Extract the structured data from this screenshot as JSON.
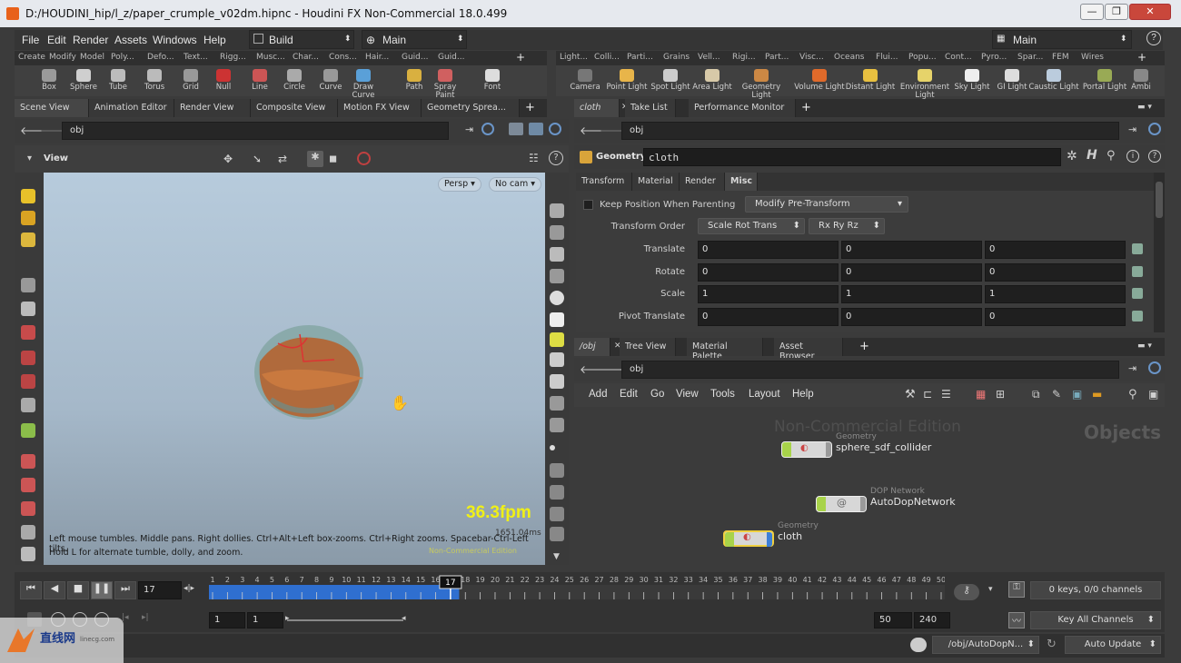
{
  "window": {
    "title": "D:/HOUDINI_hip/l_z/paper_crumple_v02dm.hipnc - Houdini FX Non-Commercial 18.0.499",
    "min": "—",
    "max": "❐",
    "close": "✕"
  },
  "menu": {
    "items": [
      "File",
      "Edit",
      "Render",
      "Assets",
      "Windows",
      "Help"
    ],
    "build": "Build",
    "desktop": "Main",
    "right_desktop": "Main",
    "help": "?"
  },
  "shelf_left": {
    "tabs": [
      "Create",
      "Modify",
      "Model",
      "Poly...",
      "Defo...",
      "Text...",
      "Rigg...",
      "Musc...",
      "Char...",
      "Cons...",
      "Hair...",
      "Guid...",
      "Guid..."
    ],
    "tools": [
      "Box",
      "Sphere",
      "Tube",
      "Torus",
      "Grid",
      "Null",
      "Line",
      "Circle",
      "Curve",
      "Draw Curve",
      "Path",
      "Spray Paint",
      "Font"
    ]
  },
  "shelf_right": {
    "tabs": [
      "Light...",
      "Colli...",
      "Parti...",
      "Grains",
      "Vell...",
      "Rigi...",
      "Part...",
      "Visc...",
      "Oceans",
      "Flui...",
      "Popu...",
      "Cont...",
      "Pyro...",
      "Spar...",
      "FEM",
      "Wires"
    ],
    "tools": [
      "Camera",
      "Point Light",
      "Spot Light",
      "Area Light",
      "Geometry Light",
      "Volume Light",
      "Distant Light",
      "Environment Light",
      "Sky Light",
      "GI Light",
      "Caustic Light",
      "Portal Light",
      "Ambi"
    ]
  },
  "scene_pane": {
    "tabs": [
      "Scene View",
      "Animation Editor",
      "Render View",
      "Composite View",
      "Motion FX View",
      "Geometry Sprea..."
    ],
    "path": "obj",
    "view_label": "View",
    "persp": "Persp ▾",
    "cam": "No cam ▾",
    "fps": "36.3fpm",
    "ms": "1651.04ms",
    "hint_line1": "Left mouse tumbles. Middle pans. Right dollies. Ctrl+Alt+Left box-zooms. Ctrl+Right zooms. Spacebar-Ctrl-Left tilts.",
    "hint_line2": "Hold L for alternate tumble, dolly, and zoom.",
    "watermark": "Non-Commercial Edition"
  },
  "param_pane": {
    "tabs": [
      "cloth",
      "Take List",
      "Performance Monitor"
    ],
    "path": "obj",
    "node_type": "Geometry",
    "node_name": "cloth",
    "subtabs": [
      "Transform",
      "Material",
      "Render",
      "Misc"
    ],
    "keep_position_label": "Keep Position When Parenting",
    "keep_position_menu": "Modify Pre-Transform",
    "transform_order_label": "Transform Order",
    "transform_order_value": "Scale Rot Trans",
    "rotate_order_value": "Rx Ry Rz",
    "rows": [
      {
        "label": "Translate",
        "values": [
          "0",
          "0",
          "0"
        ]
      },
      {
        "label": "Rotate",
        "values": [
          "0",
          "0",
          "0"
        ]
      },
      {
        "label": "Scale",
        "values": [
          "1",
          "1",
          "1"
        ]
      },
      {
        "label": "Pivot Translate",
        "values": [
          "0",
          "0",
          "0"
        ]
      }
    ]
  },
  "network_pane": {
    "tabs": [
      "/obj",
      "Tree View",
      "Material Palette",
      "Asset Browser"
    ],
    "path": "obj",
    "menu": [
      "Add",
      "Edit",
      "Go",
      "View",
      "Tools",
      "Layout",
      "Help"
    ],
    "watermark": "Non-Commercial Edition",
    "context": "Objects",
    "nodes": [
      {
        "type": "Geometry",
        "name": "sphere_sdf_collider"
      },
      {
        "type": "DOP Network",
        "name": "AutoDopNetwork"
      },
      {
        "type": "Geometry",
        "name": "cloth"
      }
    ]
  },
  "timeline": {
    "current_frame": "17",
    "frame_marker": "17",
    "ticks": [
      "1",
      "2",
      "3",
      "4",
      "5",
      "6",
      "7",
      "8",
      "9",
      "10",
      "11",
      "12",
      "13",
      "14",
      "15",
      "16",
      "17",
      "18",
      "19",
      "20",
      "21",
      "22",
      "23",
      "24",
      "25",
      "26",
      "27",
      "28",
      "29",
      "30",
      "31",
      "32",
      "33",
      "34",
      "35",
      "36",
      "37",
      "38",
      "39",
      "40",
      "41",
      "42",
      "43",
      "44",
      "45",
      "46",
      "47",
      "48",
      "49",
      "50"
    ],
    "range_start": "1",
    "range_start2": "1",
    "range_end": "50",
    "range_end2": "240",
    "keys_info": "0 keys, 0/0 channels",
    "key_all": "Key All Channels",
    "playback_progress": 0.34
  },
  "status": {
    "path": "/obj/AutoDopN...",
    "update": "Auto Update"
  },
  "logo": {
    "text": "直线网",
    "sub": "linecg.com"
  }
}
